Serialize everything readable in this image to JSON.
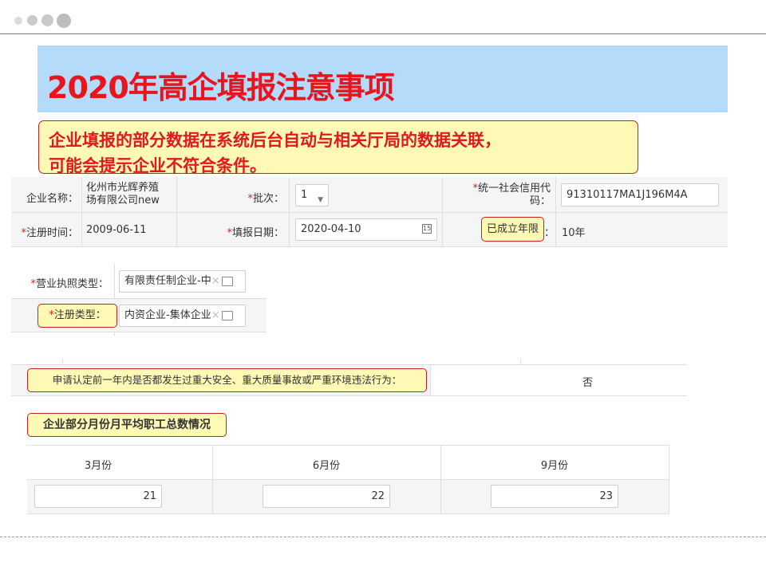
{
  "title": "2020年高企填报注意事项",
  "note": {
    "line1": "企业填报的部分数据在系统后台自动与相关厅局的数据关联，",
    "line2": "可能会提示企业不符合条件。"
  },
  "form": {
    "company_label": "企业名称：",
    "company_value_1": "化州市光辉养殖",
    "company_value_2": "场有限公司new",
    "batch_label": "批次：",
    "batch_value": "1",
    "credit_label_1": "统一社会信用代",
    "credit_label_2": "码：",
    "credit_value": "91310117MA1J196M4A",
    "reg_time_label": "注册时间：",
    "reg_time_value": "2009-06-11",
    "fill_date_label": "填报日期：",
    "fill_date_value": "2020-04-10",
    "years_label": "已成立年限",
    "years_colon": "：",
    "years_value": "10年",
    "license_label": "营业执照类型：",
    "license_value": "有限责任制企业-中",
    "reg_type_label": "注册类型：",
    "reg_type_value": "内资企业-集体企业",
    "required_mark": "*"
  },
  "safety": {
    "question": "申请认定前一年内是否都发生过重大安全、重大质量事故或严重环境违法行为：",
    "answer": "否"
  },
  "employees": {
    "heading": "企业部分月份月平均职工总数情况",
    "columns": [
      "3月份",
      "6月份",
      "9月份"
    ],
    "values": [
      "21",
      "22",
      "23"
    ]
  },
  "icons": {
    "calendar": "calendar-icon",
    "dropdown": "chevron-down-icon",
    "clear": "clear-icon",
    "folder": "folder-icon"
  },
  "colors": {
    "title_red": "#e8141e",
    "title_bg": "#b4dcfa",
    "highlight_bg": "#fff9b6",
    "highlight_border": "#c7201e"
  }
}
